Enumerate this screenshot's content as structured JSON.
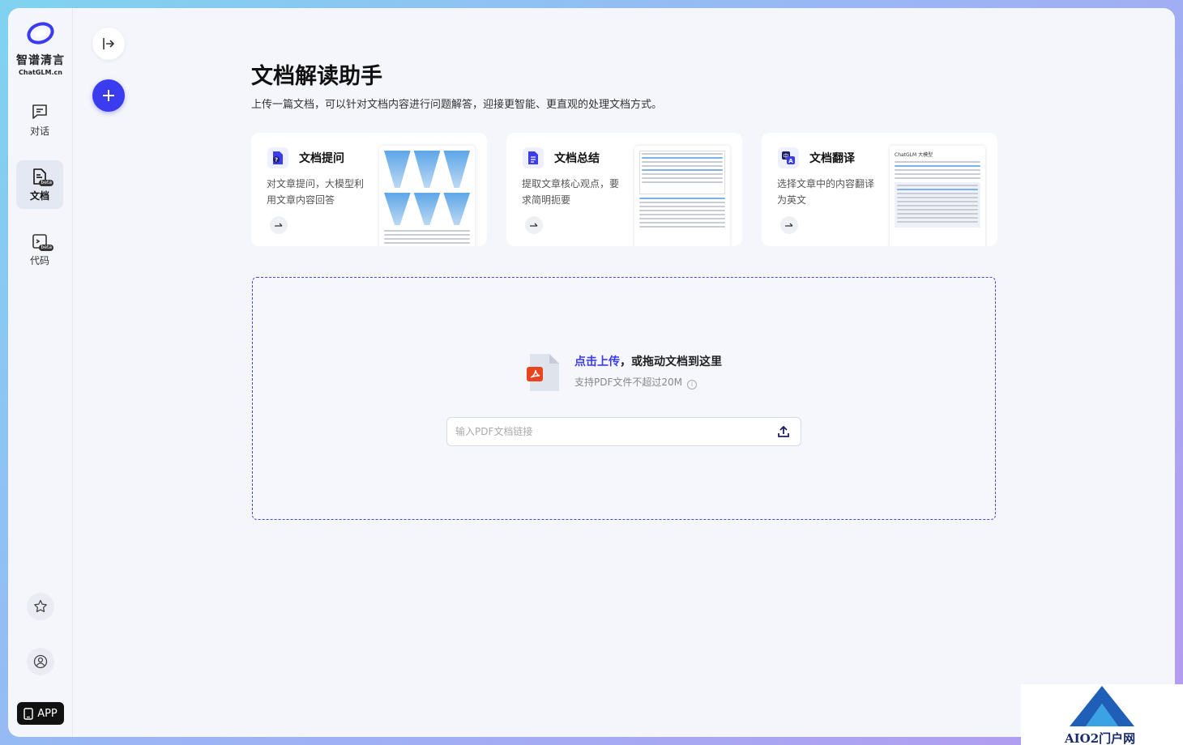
{
  "brand": {
    "name_cn": "智谱清言",
    "name_en": "ChatGLM.cn"
  },
  "sidebar": {
    "items": [
      {
        "label": "对话",
        "icon": "chat-icon",
        "active": false
      },
      {
        "label": "文档",
        "icon": "document-icon",
        "active": true,
        "badge": "beta"
      },
      {
        "label": "代码",
        "icon": "code-icon",
        "active": false,
        "badge": "beta"
      }
    ],
    "app_label": "APP"
  },
  "header": {
    "title": "文档解读助手",
    "subtitle": "上传一篇文档，可以针对文档内容进行问题解答，迎接更智能、更直观的处理文档方式。"
  },
  "cards": [
    {
      "title": "文档提问",
      "desc": "对文章提问，大模型利用文章内容回答",
      "icon": "doc-question-icon"
    },
    {
      "title": "文档总结",
      "desc": "提取文章核心观点，要求简明扼要",
      "icon": "doc-summary-icon"
    },
    {
      "title": "文档翻译",
      "desc": "选择文章中的内容翻译为英文",
      "icon": "doc-translate-icon"
    }
  ],
  "card3_preview_title": "ChatGLM 大模型",
  "upload": {
    "link_text": "点击上传",
    "main_text": "，或拖动文档到这里",
    "hint": "支持PDF文件不超过20M",
    "link_placeholder": "输入PDF文档链接"
  },
  "colors": {
    "accent": "#3b3bf0",
    "background": "#f4f6fb"
  },
  "corner_badge_text": "AIO2门户网"
}
